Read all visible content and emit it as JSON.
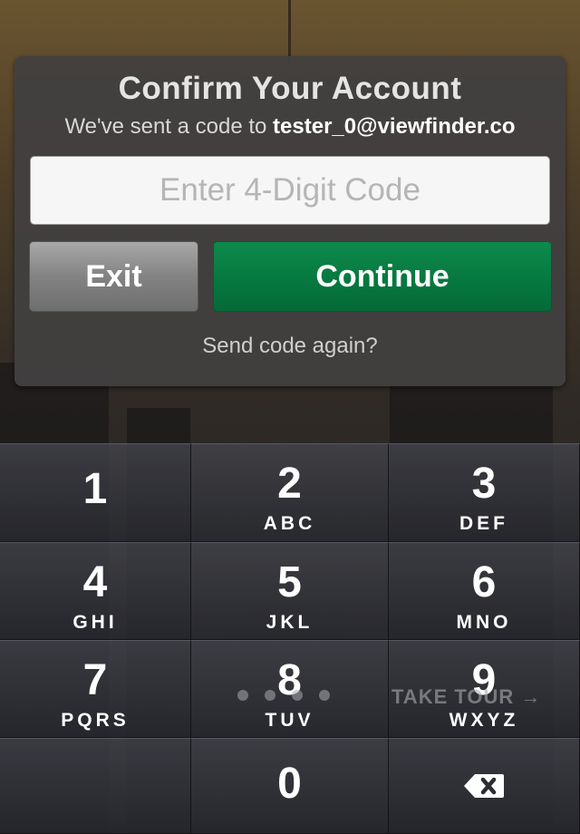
{
  "dialog": {
    "title": "Confirm Your Account",
    "subtitle_prefix": "We've sent a code to ",
    "email": "tester_0@viewfinder.co",
    "code_placeholder": "Enter 4-Digit Code",
    "code_value": "",
    "exit_label": "Exit",
    "continue_label": "Continue",
    "resend_label": "Send code again?"
  },
  "keypad": {
    "keys": [
      {
        "digit": "1",
        "letters": ""
      },
      {
        "digit": "2",
        "letters": "ABC"
      },
      {
        "digit": "3",
        "letters": "DEF"
      },
      {
        "digit": "4",
        "letters": "GHI"
      },
      {
        "digit": "5",
        "letters": "JKL"
      },
      {
        "digit": "6",
        "letters": "MNO"
      },
      {
        "digit": "7",
        "letters": "PQRS"
      },
      {
        "digit": "8",
        "letters": "TUV"
      },
      {
        "digit": "9",
        "letters": "WXYZ"
      },
      {
        "digit": "0",
        "letters": ""
      }
    ],
    "delete_icon": "backspace-icon"
  },
  "tour": {
    "label": "TAKE TOUR →",
    "page_count": 4
  },
  "colors": {
    "continue_green": "#077a41",
    "exit_gray": "#838383",
    "dialog_bg": "#424040"
  }
}
